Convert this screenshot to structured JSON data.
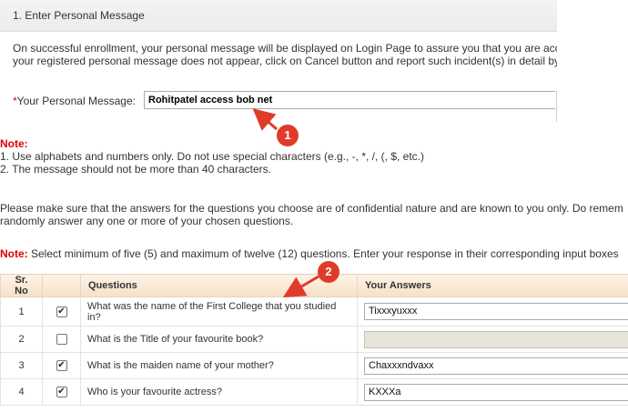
{
  "section": {
    "title": "1. Enter Personal Message"
  },
  "intro": {
    "line1": "On successful enrollment, your personal message will be displayed on Login Page to assure you that you are acc",
    "line2": "your registered personal message does not appear, click on Cancel button and report such incident(s) in detail by"
  },
  "personal_message": {
    "required_mark": "*",
    "label": "Your Personal Message:",
    "value": "Rohitpatel access bob net"
  },
  "note1": {
    "title": "Note:",
    "items": [
      "1. Use alphabets and numbers only. Do not use special characters (e.g., -, *, /, (, $, etc.)",
      "2. The message should not be more than 40 characters."
    ]
  },
  "confidentiality": {
    "line1": "Please make sure that the answers for the questions you choose are of confidential nature and are known to you only. Do remem",
    "line2": "randomly answer any one or more of your chosen questions."
  },
  "note2": {
    "title": "Note:",
    "text": " Select minimum of five (5) and maximum of twelve (12) questions. Enter your response in their corresponding input boxes"
  },
  "table": {
    "headers": {
      "sr_no": "Sr. No",
      "check": "",
      "questions": "Questions",
      "answers": "Your Answers"
    },
    "rows": [
      {
        "sr": "1",
        "checked": true,
        "question": "What was the name of the First College that you studied in?",
        "answer": "Tixxxyuxxx"
      },
      {
        "sr": "2",
        "checked": false,
        "question": "What is the Title of your favourite book?",
        "answer": ""
      },
      {
        "sr": "3",
        "checked": true,
        "question": "What is the maiden name of your mother?",
        "answer": "Chaxxxndvaxx"
      },
      {
        "sr": "4",
        "checked": true,
        "question": "Who is your favourite actress?",
        "answer": "KXXXa"
      }
    ]
  },
  "callouts": {
    "one": "1",
    "two": "2"
  },
  "colors": {
    "required": "#e00000",
    "note": "#e00000",
    "callout": "#e03b2a",
    "header_bg": "#f7e0c8"
  }
}
